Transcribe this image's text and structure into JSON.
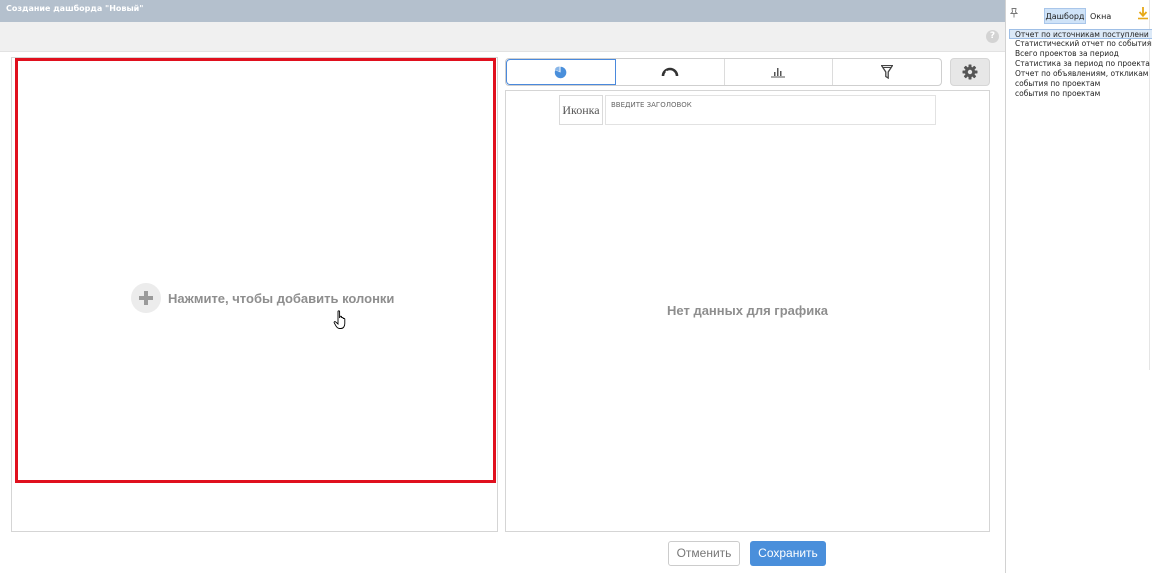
{
  "dialog": {
    "title": "Создание дашборда \"Новый\"",
    "help_label": "?"
  },
  "builder": {
    "add_columns_label": "Нажмите, чтобы добавить колонки"
  },
  "chart_types": [
    {
      "icon": "pie-chart-icon",
      "active": true
    },
    {
      "icon": "gauge-icon",
      "active": false
    },
    {
      "icon": "bar-chart-icon",
      "active": false
    },
    {
      "icon": "funnel-icon",
      "active": false
    }
  ],
  "chart": {
    "icon_button_label": "Иконка",
    "title_placeholder": "ВВЕДИТЕ ЗАГОЛОВОК",
    "empty_message": "Нет данных для графика"
  },
  "actions": {
    "cancel_label": "Отменить",
    "save_label": "Сохранить"
  },
  "sidebar": {
    "tabs": [
      "Дашборд",
      "Окна"
    ],
    "active_tab": "Дашборд",
    "items": [
      {
        "label": "Отчет по источникам поступлени",
        "selected": true
      },
      {
        "label": "Статистический отчет по событиям",
        "selected": false
      },
      {
        "label": "Всего проектов за период",
        "selected": false
      },
      {
        "label": "Статистика за период по проекта",
        "selected": false
      },
      {
        "label": "Отчет по объявлениям, откликам",
        "selected": false
      },
      {
        "label": "события по проектам",
        "selected": false
      },
      {
        "label": "события по проектам",
        "selected": false
      }
    ]
  },
  "colors": {
    "accent": "#4a8fdb",
    "highlight_frame": "#e0101e",
    "titlebar": "#b4c0cd"
  }
}
